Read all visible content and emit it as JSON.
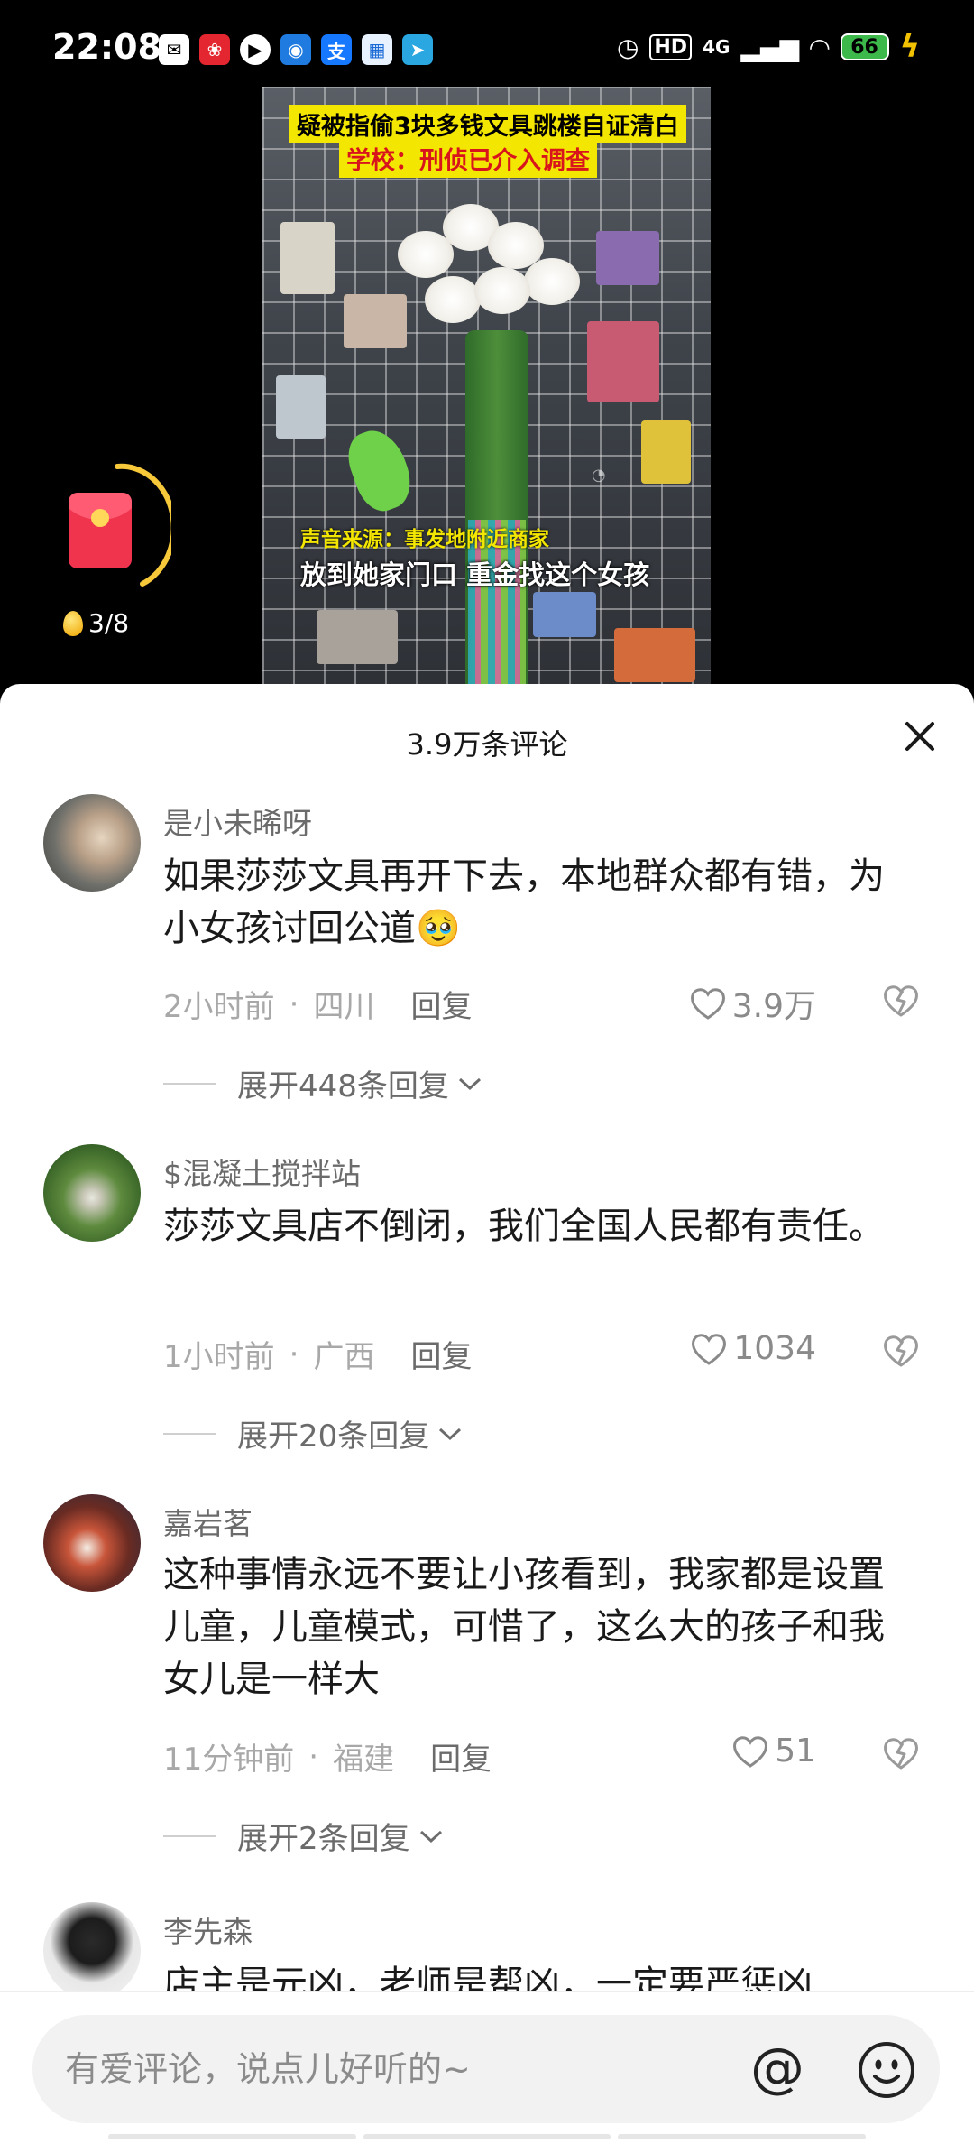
{
  "status_bar": {
    "time": "22:08",
    "notification_icons": [
      "mail-icon",
      "app-icon",
      "play-icon",
      "app-icon",
      "alipay-icon",
      "app-icon",
      "telegram-icon"
    ],
    "hd_label": "HD",
    "network_label": "4G",
    "battery_level": "66"
  },
  "video": {
    "caption_line1": "疑被指偷3块多钱文具跳楼自证清白",
    "caption_line2": "学校：刑侦已介入调查",
    "source_label": "声音来源：事发地附近商家",
    "subtitle": "放到她家门口 重金找这个女孩",
    "red_packet_progress": "3/8"
  },
  "comments_panel": {
    "title": "3.9万条评论",
    "comments": [
      {
        "username": "是小未晞呀",
        "text": "如果莎莎文具再开下去，本地群众都有错，为小女孩讨回公道🥹",
        "time": "2小时前",
        "location": "四川",
        "reply_label": "回复",
        "likes": "3.9万",
        "expand_label": "展开448条回复"
      },
      {
        "username": "$混凝土搅拌站",
        "text": "莎莎文具店不倒闭，我们全国人民都有责任。",
        "time": "1小时前",
        "location": "广西",
        "reply_label": "回复",
        "likes": "1034",
        "expand_label": "展开20条回复"
      },
      {
        "username": "嘉岩茗",
        "text": "这种事情永远不要让小孩看到，我家都是设置儿童，儿童模式，可惜了，这么大的孩子和我女儿是一样大",
        "time": "11分钟前",
        "location": "福建",
        "reply_label": "回复",
        "likes": "51",
        "expand_label": "展开2条回复"
      },
      {
        "username": "李先森",
        "text": "店主是元凶，老师是帮凶，一定要严惩凶"
      }
    ]
  },
  "input_bar": {
    "placeholder": "有爱评论，说点儿好听的~"
  }
}
